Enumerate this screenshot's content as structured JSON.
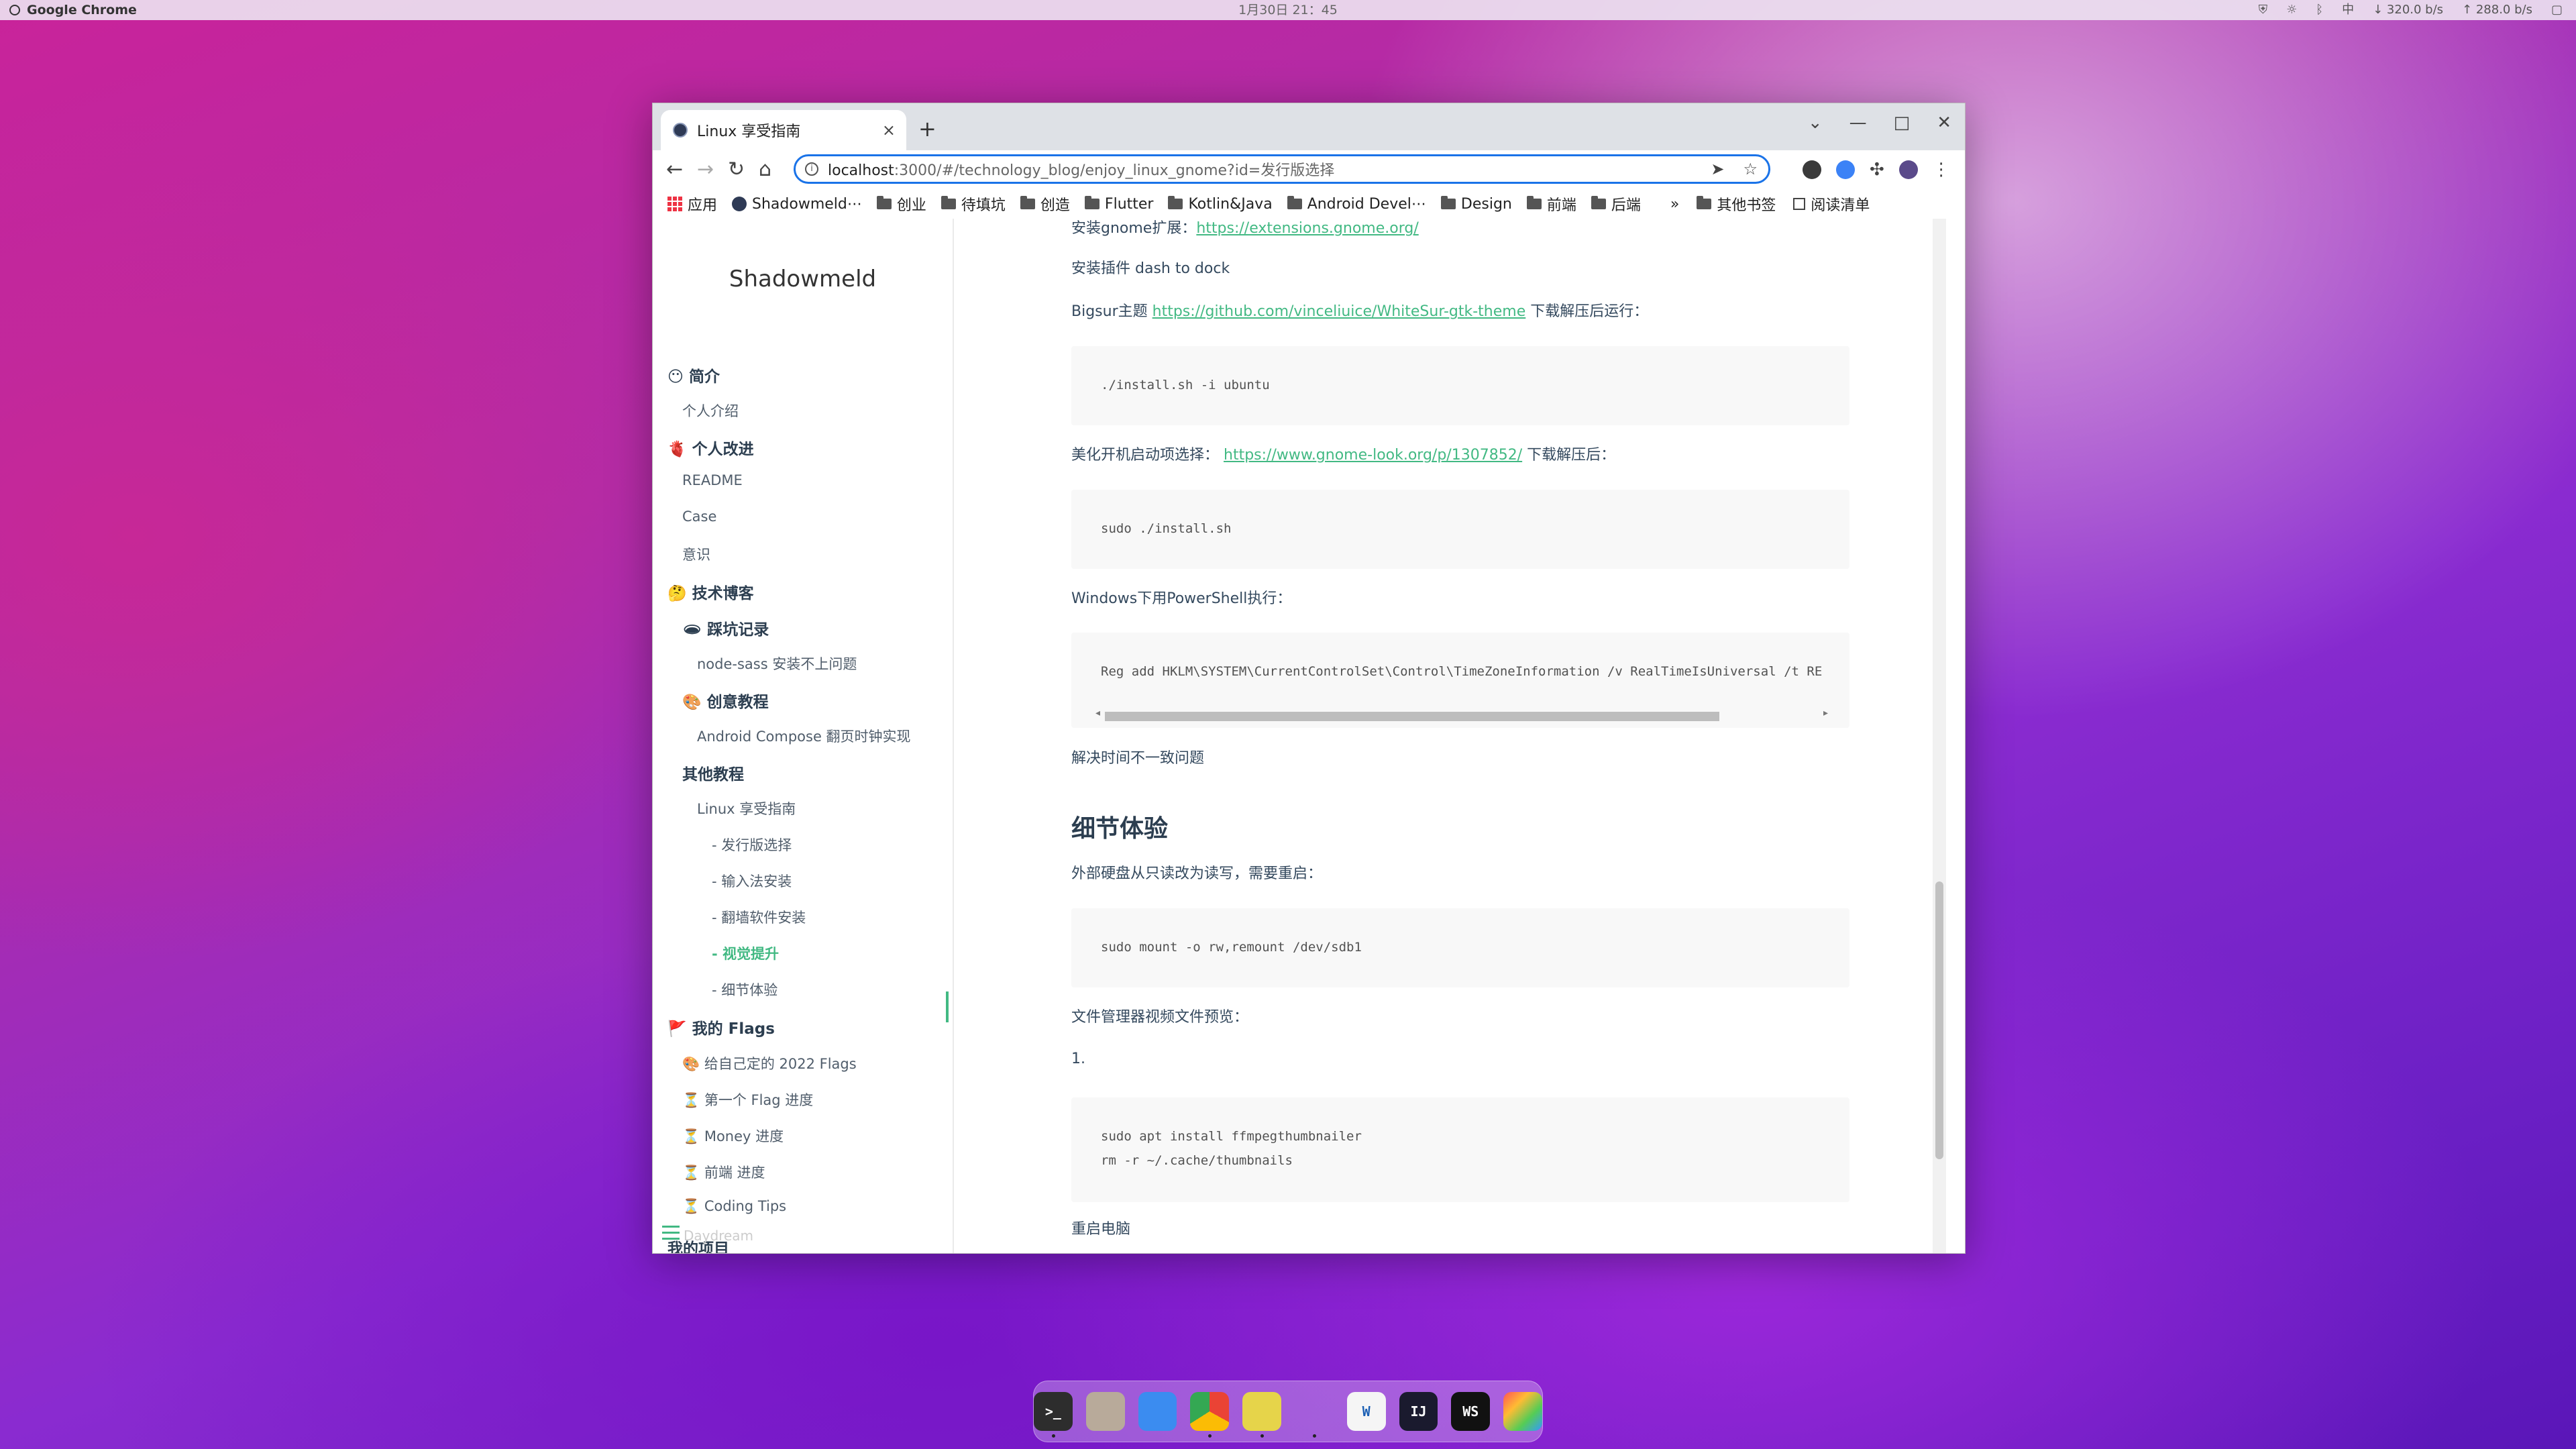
{
  "system_bar": {
    "app_name": "Google Chrome",
    "clock": "1月30日  21：45",
    "net_down": "↓ 320.0 b/s",
    "net_up": "↑ 288.0 b/s",
    "ime": "中"
  },
  "browser": {
    "tab_title": "Linux 享受指南",
    "new_tab": "+",
    "tab_close": "×",
    "url_host": "localhost",
    "url_path": ":3000/#/technology_blog/enjoy_linux_gnome?id=发行版选择",
    "window_controls": [
      "⌄",
      "—",
      "□",
      "✕"
    ],
    "bookmarks": [
      {
        "label": "应用",
        "icon": "apps-grid-icon"
      },
      {
        "label": "Shadowmeld⋯",
        "icon": "site-favicon-icon"
      },
      {
        "label": "创业",
        "icon": "folder-icon"
      },
      {
        "label": "待填坑",
        "icon": "folder-icon"
      },
      {
        "label": "创造",
        "icon": "folder-icon"
      },
      {
        "label": "Flutter",
        "icon": "folder-icon"
      },
      {
        "label": "Kotlin&Java",
        "icon": "folder-icon"
      },
      {
        "label": "Android Devel⋯",
        "icon": "folder-icon"
      },
      {
        "label": "Design",
        "icon": "folder-icon"
      },
      {
        "label": "前端",
        "icon": "folder-icon"
      },
      {
        "label": "后端",
        "icon": "folder-icon"
      }
    ],
    "bookmarks_more": "»",
    "other_bookmarks": "其他书签",
    "reading_list": "阅读清单"
  },
  "sidebar": {
    "site_title": "Shadowmeld",
    "items": [
      {
        "label": "😶 简介",
        "level": "h"
      },
      {
        "label": "个人介绍",
        "level": "1"
      },
      {
        "label": "🫀 个人改进",
        "level": "h"
      },
      {
        "label": "README",
        "level": "1"
      },
      {
        "label": "Case",
        "level": "1"
      },
      {
        "label": "意识",
        "level": "1"
      },
      {
        "label": "🤔 技术博客",
        "level": "h"
      },
      {
        "label": "🕳 踩坑记录",
        "level": "h2"
      },
      {
        "label": "node-sass 安装不上问题",
        "level": "2"
      },
      {
        "label": "🎨 创意教程",
        "level": "h2"
      },
      {
        "label": "Android Compose 翻页时钟实现",
        "level": "2"
      },
      {
        "label": "其他教程",
        "level": "h2"
      },
      {
        "label": "Linux 享受指南",
        "level": "2"
      },
      {
        "label": "- 发行版选择",
        "level": "3"
      },
      {
        "label": "- 输入法安装",
        "level": "3"
      },
      {
        "label": "- 翻墙软件安装",
        "level": "3"
      },
      {
        "label": "- 视觉提升",
        "level": "3",
        "active": true
      },
      {
        "label": "- 细节体验",
        "level": "3"
      },
      {
        "label": "🚩 我的 Flags",
        "level": "h"
      },
      {
        "label": "🎨 给自己定的 2022 Flags",
        "level": "1"
      },
      {
        "label": "⏳ 第一个 Flag 进度",
        "level": "1"
      },
      {
        "label": "⏳ Money 进度",
        "level": "1"
      },
      {
        "label": "⏳ 前端 进度",
        "level": "1"
      },
      {
        "label": "⏳ Coding Tips",
        "level": "1"
      },
      {
        "label": "我的项目",
        "level": "h"
      }
    ],
    "faded_item": "Daydream"
  },
  "article": {
    "p1_text": "安装gnome扩展：",
    "p1_link": "https://extensions.gnome.org/",
    "p2": "安装插件 dash to dock",
    "p3_prefix": "Bigsur主题 ",
    "p3_link": "https://github.com/vinceliuice/WhiteSur-gtk-theme",
    "p3_suffix": " 下载解压后运行：",
    "code1": "./install.sh -i ubuntu",
    "p4_prefix": "美化开机启动项选择： ",
    "p4_link": "https://www.gnome-look.org/p/1307852/",
    "p4_suffix": " 下载解压后：",
    "code2": "sudo ./install.sh",
    "p5": "Windows下用PowerShell执行：",
    "code3": "Reg add HKLM\\SYSTEM\\CurrentControlSet\\Control\\TimeZoneInformation /v RealTimeIsUniversal /t RE",
    "p6": "解决时间不一致问题",
    "h2": "细节体验",
    "p7": "外部硬盘从只读改为读写，需要重启：",
    "code4": "sudo mount -o rw,remount /dev/sdb1",
    "p8": "文件管理器视频文件预览：",
    "p9": "1.",
    "code5": "sudo apt install ffmpegthumbnailer\nrm -r ~/.cache/thumbnails",
    "p10": "重启电脑"
  },
  "dock": {
    "items": [
      {
        "name": "terminal-icon",
        "label": ">_",
        "color": "#2d2d2d",
        "running": true
      },
      {
        "name": "files-icon",
        "label": "",
        "color": "#b8aa9a",
        "running": false
      },
      {
        "name": "finder-cat-icon",
        "label": "",
        "color": "#3b8cf0",
        "running": false
      },
      {
        "name": "chrome-icon",
        "label": "",
        "color": "#ffffff",
        "running": true
      },
      {
        "name": "leaf-app-icon",
        "label": "",
        "color": "#e6d44a",
        "running": true
      },
      {
        "name": "vscode-icon",
        "label": "",
        "color": "#ffffff",
        "running": true
      },
      {
        "name": "writer-icon",
        "label": "W",
        "color": "#f5f5f5",
        "running": false
      },
      {
        "name": "intellij-icon",
        "label": "IJ",
        "color": "#1a1a2e",
        "running": false
      },
      {
        "name": "webstorm-icon",
        "label": "WS",
        "color": "#111111",
        "running": false
      },
      {
        "name": "app-grid-icon",
        "label": "",
        "color": "#ffffff",
        "running": false
      }
    ]
  }
}
